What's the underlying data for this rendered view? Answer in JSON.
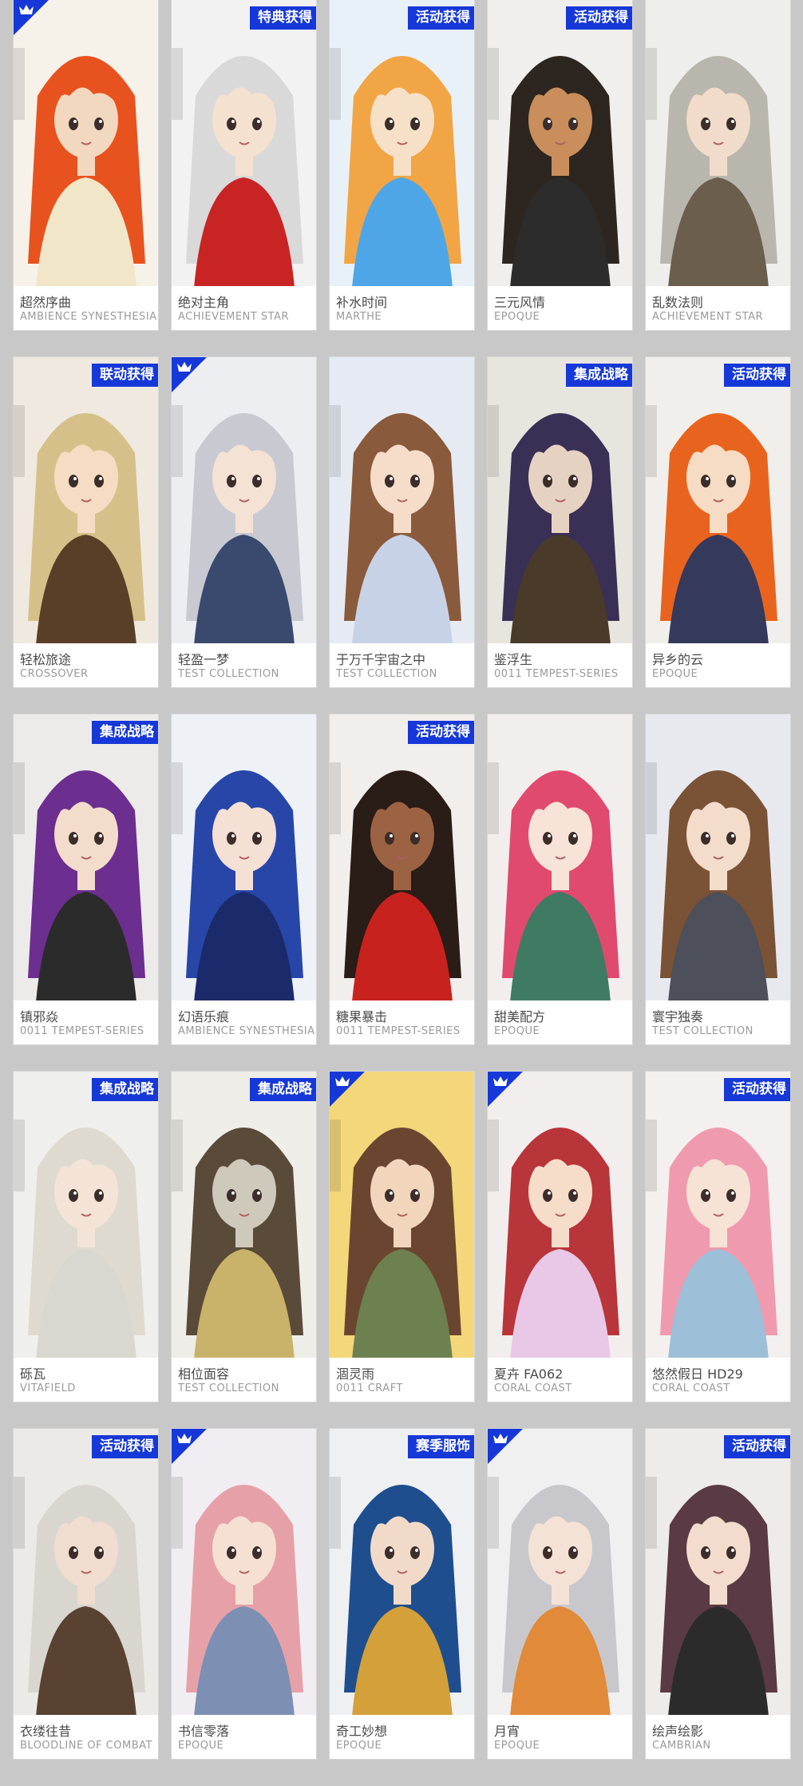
{
  "colors": {
    "background": "#c8c8c8",
    "card": "#ffffff",
    "tag": "#1638d8",
    "name_text": "#4a4a4a",
    "series_text": "#9a9a9a"
  },
  "cards": [
    {
      "name": "超然序曲",
      "series": "AMBIENCE SYNESTHESIA",
      "tag": "",
      "corner_icon": true,
      "hair": "#e8521f",
      "skin": "#f3d8c0",
      "outfit": "#f1e6c8",
      "bg": "#f6f2ea"
    },
    {
      "name": "绝对主角",
      "series": "ACHIEVEMENT STAR",
      "tag": "特典获得",
      "corner_icon": false,
      "hair": "#d9d9d9",
      "skin": "#f5e1d0",
      "outfit": "#c92424",
      "bg": "#f2f2f2"
    },
    {
      "name": "补水时间",
      "series": "MARTHE",
      "tag": "活动获得",
      "corner_icon": false,
      "hair": "#f2a545",
      "skin": "#f7e0c8",
      "outfit": "#4ea6e6",
      "bg": "#e9f1f8"
    },
    {
      "name": "三元风情",
      "series": "EPOQUE",
      "tag": "活动获得",
      "corner_icon": false,
      "hair": "#2d2620",
      "skin": "#c98e5b",
      "outfit": "#2c2c2c",
      "bg": "#f0efed"
    },
    {
      "name": "乱数法则",
      "series": "ACHIEVEMENT STAR",
      "tag": "",
      "corner_icon": false,
      "hair": "#b9b6ad",
      "skin": "#f1dccb",
      "outfit": "#6b5e4d",
      "bg": "#eeeeec"
    },
    {
      "name": "轻松旅途",
      "series": "CROSSOVER",
      "tag": "联动获得",
      "corner_icon": false,
      "hair": "#d6c08a",
      "skin": "#f5dcc2",
      "outfit": "#5a3f28",
      "bg": "#efe9df"
    },
    {
      "name": "轻盈一梦",
      "series": "TEST COLLECTION",
      "tag": "",
      "corner_icon": true,
      "hair": "#c9c9d2",
      "skin": "#f4e2d5",
      "outfit": "#3a4a6e",
      "bg": "#eceef2"
    },
    {
      "name": "于万千宇宙之中",
      "series": "TEST COLLECTION",
      "tag": "",
      "corner_icon": false,
      "hair": "#8a5a3c",
      "skin": "#f5ddca",
      "outfit": "#c8d2e6",
      "bg": "#e6ebf3"
    },
    {
      "name": "鉴浮生",
      "series": "0011 TEMPEST-SERIES",
      "tag": "集成战略",
      "corner_icon": false,
      "hair": "#3a2f55",
      "skin": "#e6d2c2",
      "outfit": "#4a3a2a",
      "bg": "#e8e5df"
    },
    {
      "name": "异乡的云",
      "series": "EPOQUE",
      "tag": "活动获得",
      "corner_icon": false,
      "hair": "#e8641e",
      "skin": "#f6dcc4",
      "outfit": "#35395c",
      "bg": "#f1efeb"
    },
    {
      "name": "镇邪焱",
      "series": "0011 TEMPEST-SERIES",
      "tag": "集成战略",
      "corner_icon": false,
      "hair": "#6c2e8f",
      "skin": "#f3dccb",
      "outfit": "#2b2b2b",
      "bg": "#ecebea"
    },
    {
      "name": "幻语乐痕",
      "series": "AMBIENCE SYNESTHESIA",
      "tag": "",
      "corner_icon": false,
      "hair": "#2746a8",
      "skin": "#f4e0d4",
      "outfit": "#1b2a6a",
      "bg": "#eef1f6"
    },
    {
      "name": "糖果暴击",
      "series": "0011 TEMPEST-SERIES",
      "tag": "活动获得",
      "corner_icon": false,
      "hair": "#2a1c16",
      "skin": "#9b6343",
      "outfit": "#c8221f",
      "bg": "#f1eeec"
    },
    {
      "name": "甜美配方",
      "series": "EPOQUE",
      "tag": "",
      "corner_icon": false,
      "hair": "#e04a6e",
      "skin": "#f7e3d8",
      "outfit": "#3f7a62",
      "bg": "#f3eeee"
    },
    {
      "name": "寰宇独奏",
      "series": "TEST COLLECTION",
      "tag": "",
      "corner_icon": false,
      "hair": "#7a5236",
      "skin": "#f4dccb",
      "outfit": "#4d4f5a",
      "bg": "#e8e9ee"
    },
    {
      "name": "砾瓦",
      "series": "VITAFIELD",
      "tag": "集成战略",
      "corner_icon": false,
      "hair": "#dedad0",
      "skin": "#f4e4d8",
      "outfit": "#d8d8d0",
      "bg": "#efefed"
    },
    {
      "name": "相位面容",
      "series": "TEST COLLECTION",
      "tag": "集成战略",
      "corner_icon": false,
      "hair": "#5a4a3a",
      "skin": "#cfc9bc",
      "outfit": "#c9b36a",
      "bg": "#efede7"
    },
    {
      "name": "涸灵雨",
      "series": "0011 CRAFT",
      "tag": "",
      "corner_icon": true,
      "hair": "#6a4630",
      "skin": "#f2d6bb",
      "outfit": "#6d8050",
      "bg": "#f3d77a"
    },
    {
      "name": "夏卉 FA062",
      "series": "CORAL COAST",
      "tag": "",
      "corner_icon": true,
      "hair": "#b8353a",
      "skin": "#f6ddca",
      "outfit": "#e8c8e6",
      "bg": "#f2eeee"
    },
    {
      "name": "悠然假日 HD29",
      "series": "CORAL COAST",
      "tag": "活动获得",
      "corner_icon": false,
      "hair": "#ef9aae",
      "skin": "#f7e2d6",
      "outfit": "#9dbfd8",
      "bg": "#f3f0ef"
    },
    {
      "name": "衣缕往昔",
      "series": "BLOODLINE OF COMBAT",
      "tag": "活动获得",
      "corner_icon": false,
      "hair": "#d9d6cf",
      "skin": "#f0ddcf",
      "outfit": "#5a4232",
      "bg": "#eceae6"
    },
    {
      "name": "书信零落",
      "series": "EPOQUE",
      "tag": "",
      "corner_icon": true,
      "hair": "#e6a1a8",
      "skin": "#f6e0d4",
      "outfit": "#7d8fb2",
      "bg": "#f0eef2"
    },
    {
      "name": "奇工妙想",
      "series": "EPOQUE",
      "tag": "赛季服饰",
      "corner_icon": false,
      "hair": "#1f4e8e",
      "skin": "#f2dac8",
      "outfit": "#d4a03a",
      "bg": "#eef0f2"
    },
    {
      "name": "月宵",
      "series": "EPOQUE",
      "tag": "",
      "corner_icon": true,
      "hair": "#c8c8cc",
      "skin": "#f5e2d6",
      "outfit": "#e08a3a",
      "bg": "#f1f0f0"
    },
    {
      "name": "绘声绘影",
      "series": "CAMBRIAN",
      "tag": "活动获得",
      "corner_icon": false,
      "hair": "#5a3a44",
      "skin": "#f3dccd",
      "outfit": "#2b2b2b",
      "bg": "#eeecea"
    }
  ]
}
